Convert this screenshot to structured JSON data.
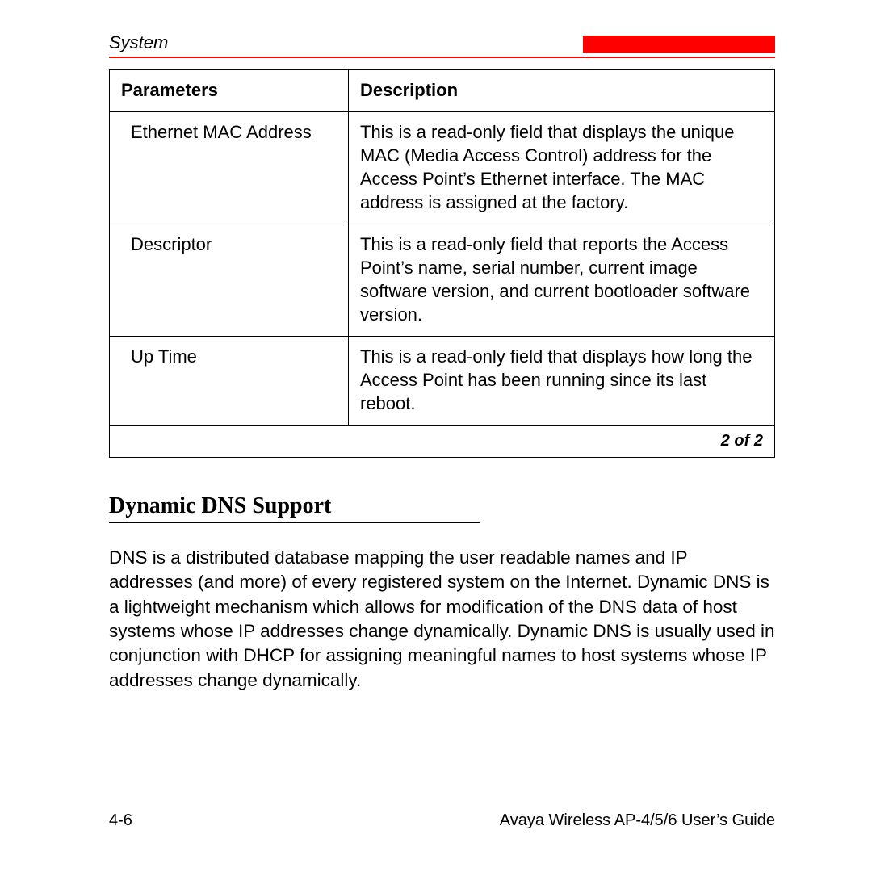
{
  "header": {
    "section_label": "System"
  },
  "table": {
    "headers": {
      "param": "Parameters",
      "desc": "Description"
    },
    "rows": [
      {
        "param": "Ethernet MAC Address",
        "desc": "This is a read-only field that displays the unique MAC (Media Access Control) address for the Access Point’s Ethernet interface. The MAC address is assigned at the factory."
      },
      {
        "param": "Descriptor",
        "desc": "This is a read-only field that reports the Access Point’s name, serial number, current image software version, and current bootloader software version."
      },
      {
        "param": "Up Time",
        "desc": "This is a read-only field that displays how long the Access Point has been running since its last reboot."
      }
    ],
    "pager": "2 of 2"
  },
  "section": {
    "heading": "Dynamic DNS Support",
    "body": "DNS is a distributed database mapping the user readable names and IP addresses (and more) of every registered system on the Internet. Dynamic DNS is a lightweight mechanism which allows for modification of the DNS data of host systems whose IP addresses change dynamically. Dynamic DNS is usually used in conjunction with DHCP for assigning meaningful names to host systems whose IP addresses change dynamically."
  },
  "footer": {
    "page_number": "4-6",
    "doc_title": "Avaya Wireless AP-4/5/6 User’s Guide"
  }
}
